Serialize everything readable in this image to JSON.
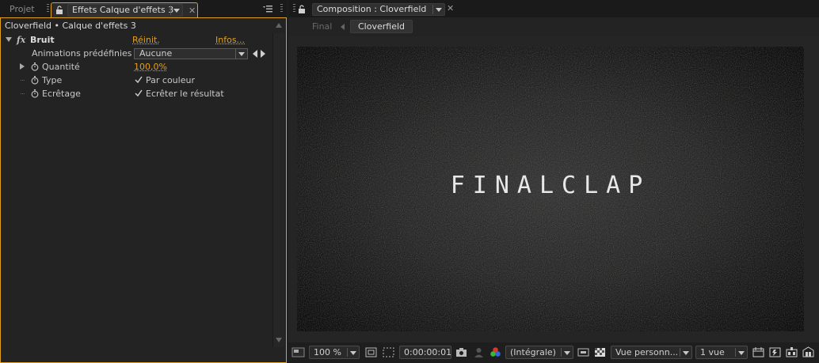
{
  "left_panel": {
    "tabs": {
      "project": "Projet",
      "effects": "Effets Calque d'effets 3"
    },
    "breadcrumb": "Cloverfield • Calque d'effets 3",
    "effect": {
      "name": "Bruit",
      "reset": "Réinit.",
      "about": "Infos...",
      "preset_label": "Animations prédéfinies :",
      "preset_value": "Aucune",
      "params": [
        {
          "label": "Quantité",
          "value": "100,0%"
        },
        {
          "label": "Type",
          "value": "Par couleur"
        },
        {
          "label": "Ecrêtage",
          "value": "Ecrêter le résultat"
        }
      ]
    }
  },
  "right_panel": {
    "tab": "Composition : Cloverfield",
    "nav": {
      "previous": "Final",
      "current": "Cloverfield"
    },
    "canvas_text": "FINALCLAP",
    "footer": {
      "zoom": "100 %",
      "timecode": "0:00:00:01",
      "resolution": "(Intégrale)",
      "view": "Vue personn...",
      "views_count": "1 vue"
    }
  },
  "colors": {
    "accent": "#e0a020",
    "panel": "#232323",
    "tabbar": "#1a1a1a"
  },
  "icons": [
    "lock-icon",
    "menu-icon",
    "fx-icon",
    "stopwatch-icon",
    "checkbox-icon",
    "snapshot-icon",
    "channel-icon",
    "transparency-grid-icon"
  ]
}
